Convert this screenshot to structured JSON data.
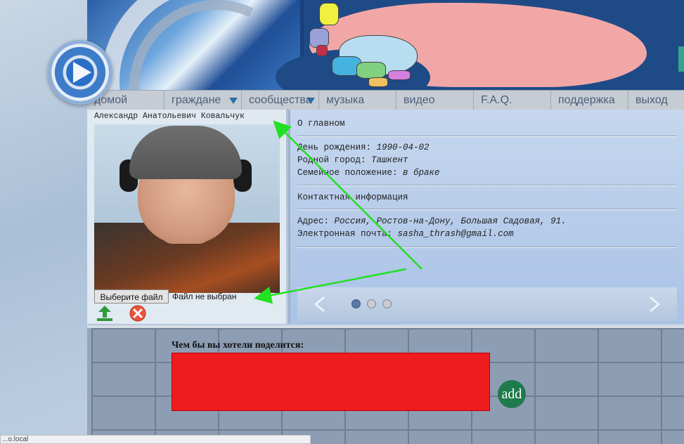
{
  "nav": {
    "items": [
      {
        "label": "домой",
        "has_dropdown": false
      },
      {
        "label": "граждане",
        "has_dropdown": true
      },
      {
        "label": "сообщества",
        "has_dropdown": true
      },
      {
        "label": "музыка",
        "has_dropdown": false
      },
      {
        "label": "видео",
        "has_dropdown": false
      },
      {
        "label": "F.A.Q.",
        "has_dropdown": false
      },
      {
        "label": "поддержка",
        "has_dropdown": false
      },
      {
        "label": "выход",
        "has_dropdown": false
      }
    ]
  },
  "profile": {
    "name": "Александр Анатольевич Ковальчук",
    "file_button": "Выберите файл",
    "file_status": "Файл не выбран"
  },
  "about": {
    "title": "О главном",
    "birthday_label": "День рождения:",
    "birthday_value": "1990-04-02",
    "hometown_label": "Родной город:",
    "hometown_value": "Ташкент",
    "marital_label": "Семейное положение:",
    "marital_value": "в браке",
    "contacts_title": "Контактная информация",
    "address_label": "Адрес:",
    "address_value": "Россия, Ростов-на-Дону, Большая Садовая, 91.",
    "email_label": "Электронная почта:",
    "email_value": "sasha_thrash@gmail.com"
  },
  "slider": {
    "dots": 3,
    "active": 0
  },
  "post": {
    "label": "Чем бы вы хотели поделится:",
    "textarea_value": "",
    "add_label": "add"
  },
  "status_bar": {
    "text": "...o.local"
  },
  "colors": {
    "textarea_bg": "#ef1c1f",
    "add_button": "#1f7a4c",
    "annotation_arrow": "#22e022",
    "nav_bg": "#c6ccd4"
  }
}
